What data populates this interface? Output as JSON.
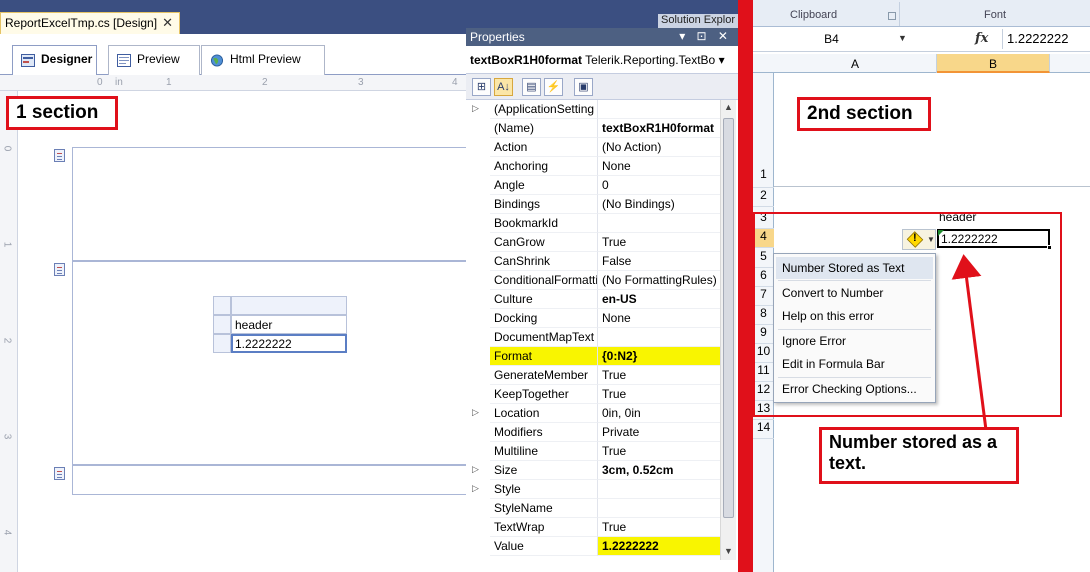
{
  "vs": {
    "doc_tab_title": "ReportExcelTmp.cs [Design]",
    "doc_tab_close": "✕",
    "solution_tab": "Solution Explor",
    "designer_tabs": [
      "Designer",
      "Preview",
      "Html Preview"
    ],
    "ruler_top": [
      "0",
      "in",
      "1",
      "2",
      "3",
      "4"
    ],
    "ruler_side": [
      "0",
      "1",
      "2",
      "3",
      "4"
    ],
    "table_header_text": "header",
    "table_value_text": "1.2222222",
    "callout_1": "1 section"
  },
  "properties": {
    "title": "Properties",
    "title_buttons": "▾ ⊡ ✕",
    "object_name": "textBoxR1H0format",
    "object_type": "Telerik.Reporting.TextBo",
    "toolbar": [
      "⊞",
      "A↓",
      "▤",
      "⚡",
      "▣"
    ],
    "rows": [
      {
        "expand": "▷",
        "name": "(ApplicationSetting",
        "value": "",
        "bold": false
      },
      {
        "expand": "",
        "name": "(Name)",
        "value": "textBoxR1H0format",
        "bold": true
      },
      {
        "expand": "",
        "name": "Action",
        "value": "(No Action)",
        "bold": false
      },
      {
        "expand": "",
        "name": "Anchoring",
        "value": "None",
        "bold": false
      },
      {
        "expand": "",
        "name": "Angle",
        "value": "0",
        "bold": false
      },
      {
        "expand": "",
        "name": "Bindings",
        "value": "(No Bindings)",
        "bold": false
      },
      {
        "expand": "",
        "name": "BookmarkId",
        "value": "",
        "bold": false
      },
      {
        "expand": "",
        "name": "CanGrow",
        "value": "True",
        "bold": false
      },
      {
        "expand": "",
        "name": "CanShrink",
        "value": "False",
        "bold": false
      },
      {
        "expand": "",
        "name": "ConditionalFormatti",
        "value": "(No FormattingRules)",
        "bold": false
      },
      {
        "expand": "",
        "name": "Culture",
        "value": "en-US",
        "bold": true
      },
      {
        "expand": "",
        "name": "Docking",
        "value": "None",
        "bold": false
      },
      {
        "expand": "",
        "name": "DocumentMapText",
        "value": "",
        "bold": false
      },
      {
        "expand": "",
        "name": "Format",
        "value": "{0:N2}",
        "bold": true
      },
      {
        "expand": "",
        "name": "GenerateMember",
        "value": "True",
        "bold": false
      },
      {
        "expand": "",
        "name": "KeepTogether",
        "value": "True",
        "bold": false
      },
      {
        "expand": "▷",
        "name": "Location",
        "value": "0in, 0in",
        "bold": false
      },
      {
        "expand": "",
        "name": "Modifiers",
        "value": "Private",
        "bold": false
      },
      {
        "expand": "",
        "name": "Multiline",
        "value": "True",
        "bold": false
      },
      {
        "expand": "▷",
        "name": "Size",
        "value": "3cm, 0.52cm",
        "bold": true
      },
      {
        "expand": "▷",
        "name": "Style",
        "value": "",
        "bold": false
      },
      {
        "expand": "",
        "name": "StyleName",
        "value": "",
        "bold": false
      },
      {
        "expand": "",
        "name": "TextWrap",
        "value": "True",
        "bold": false
      },
      {
        "expand": "",
        "name": "Value",
        "value": "1.2222222",
        "bold": true
      }
    ]
  },
  "excel": {
    "ribbon_group_clipboard": "Clipboard",
    "ribbon_group_font": "Font",
    "name_box": "B4",
    "fx": "fx",
    "formula_value": "1.2222222",
    "columns": [
      "A",
      "B"
    ],
    "rows": [
      "1",
      "2",
      "3",
      "4",
      "5",
      "6",
      "7",
      "8",
      "9",
      "10",
      "11",
      "12",
      "13",
      "14"
    ],
    "cell_b3": "header",
    "cell_b4": "1.2222222",
    "error_menu": [
      "Number Stored as Text",
      "Convert to Number",
      "Help on this error",
      "Ignore Error",
      "Edit in Formula Bar",
      "Error Checking Options..."
    ],
    "callout_2": "2nd section",
    "callout_3_line1": "Number stored as a",
    "callout_3_line2": "text."
  },
  "colors": {
    "annotation_red": "#e0101a",
    "highlight_yellow": "#f9f500",
    "vs_chrome": "#293955",
    "excel_selected_header": "#f8d78a"
  }
}
